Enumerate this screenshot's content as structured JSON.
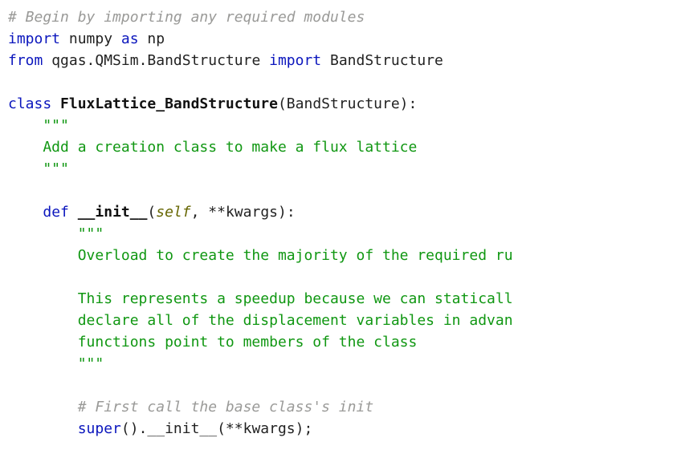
{
  "code": {
    "l01": "# Begin by importing any required modules",
    "l02a": "import",
    "l02b": " numpy ",
    "l02c": "as",
    "l02d": " np",
    "l03a": "from",
    "l03b": " qgas.QMSim.BandStructure ",
    "l03c": "import",
    "l03d": " BandStructure",
    "l05a": "class",
    "l05b": " ",
    "l05c": "FluxLattice_BandStructure",
    "l05d": "(BandStructure):",
    "l06": "    \"\"\"",
    "l07": "    Add a creation class to make a flux lattice",
    "l08": "    \"\"\"",
    "l10a": "    ",
    "l10b": "def",
    "l10c": " ",
    "l10d": "__init__",
    "l10e": "(",
    "l10f": "self",
    "l10g": ", **kwargs):",
    "l11": "        \"\"\"",
    "l12": "        Overload to create the majority of the required ru",
    "l14": "        This represents a speedup because we can staticall",
    "l15": "        declare all of the displacement variables in advan",
    "l16": "        functions point to members of the class",
    "l17": "        \"\"\"",
    "l19": "        # First call the base class's init",
    "l20a": "        ",
    "l20b": "super",
    "l20c": "().__init__(**kwargs);"
  }
}
